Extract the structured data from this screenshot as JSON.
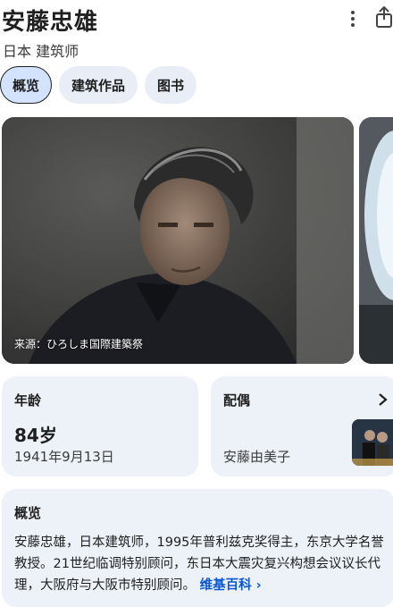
{
  "header": {
    "title": "安藤忠雄",
    "subtitle": "日本 建筑师",
    "more_icon": "more-vert-icon",
    "share_icon": "share-icon"
  },
  "tabs": [
    {
      "label": "概览",
      "active": true
    },
    {
      "label": "建筑作品",
      "active": false
    },
    {
      "label": "图书",
      "active": false
    }
  ],
  "photo": {
    "credit": "来源：ひろしま国際建築祭"
  },
  "age_card": {
    "label": "年龄",
    "value": "84岁",
    "birth_date": "1941年9月13日"
  },
  "spouse_card": {
    "label": "配偶",
    "name": "安藤由美子",
    "chevron_icon": "chevron-right-icon"
  },
  "overview_card": {
    "label": "概览",
    "text": "安藤忠雄，日本建筑师，1995年普利兹克奖得主，东京大学名誉教授。21世纪临调特别顾问，东日本大震灾复兴构想会议议长代理，大阪府与大阪市特别顾问。",
    "link": "维基百科 ›"
  },
  "colors": {
    "accent": "#0b57d0",
    "chip_bg": "#e9eef6",
    "chip_active_bg": "#d3e3fd",
    "card_bg": "#edf2f8"
  }
}
